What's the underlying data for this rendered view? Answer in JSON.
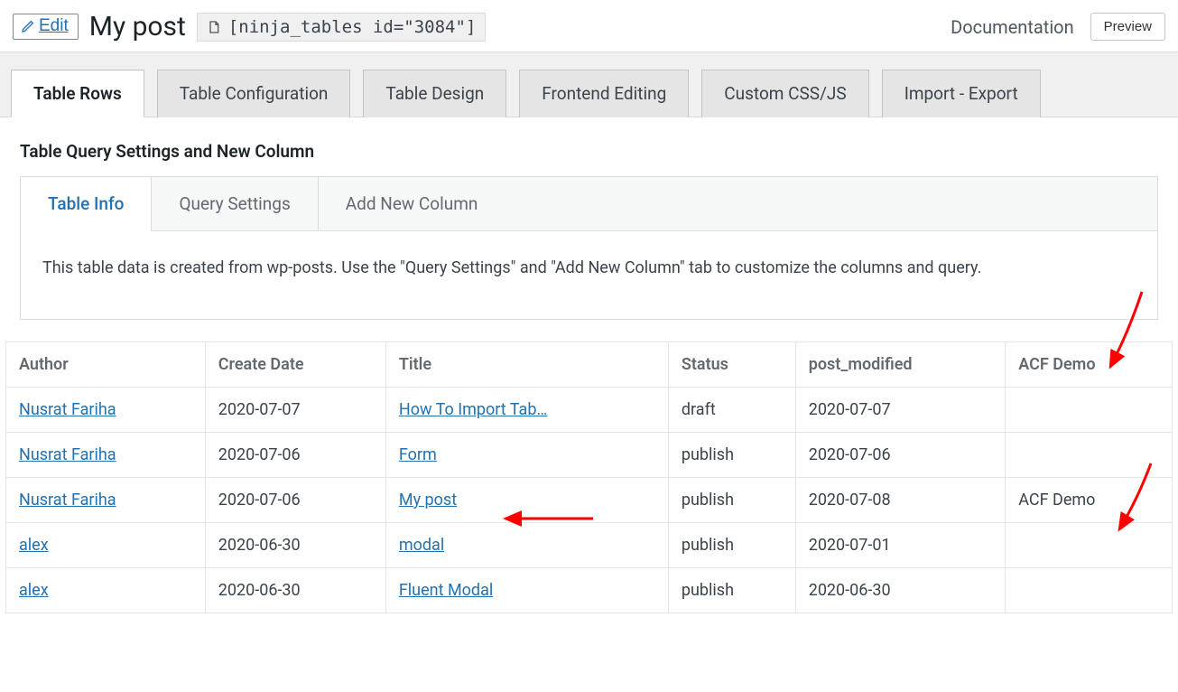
{
  "header": {
    "edit_label": "Edit",
    "title": "My post",
    "shortcode": "[ninja_tables id=\"3084\"]",
    "documentation_label": "Documentation",
    "preview_label": "Preview"
  },
  "main_tabs": [
    {
      "label": "Table Rows",
      "active": true
    },
    {
      "label": "Table Configuration",
      "active": false
    },
    {
      "label": "Table Design",
      "active": false
    },
    {
      "label": "Frontend Editing",
      "active": false
    },
    {
      "label": "Custom CSS/JS",
      "active": false
    },
    {
      "label": "Import - Export",
      "active": false
    }
  ],
  "section_title": "Table Query Settings and New Column",
  "sub_tabs": [
    {
      "label": "Table Info",
      "active": true
    },
    {
      "label": "Query Settings",
      "active": false
    },
    {
      "label": "Add New Column",
      "active": false
    }
  ],
  "info_text": "This table data is created from wp-posts. Use the \"Query Settings\" and \"Add New Column\" tab to customize the columns and query.",
  "table": {
    "columns": [
      "Author",
      "Create Date",
      "Title",
      "Status",
      "post_modified",
      "ACF Demo"
    ],
    "rows": [
      {
        "author": "Nusrat Fariha",
        "create_date": "2020-07-07",
        "title": "How To Import Tab…",
        "status": "draft",
        "post_modified": "2020-07-07",
        "acf_demo": ""
      },
      {
        "author": "Nusrat Fariha",
        "create_date": "2020-07-06",
        "title": "Form",
        "status": "publish",
        "post_modified": "2020-07-06",
        "acf_demo": ""
      },
      {
        "author": "Nusrat Fariha",
        "create_date": "2020-07-06",
        "title": "My post",
        "status": "publish",
        "post_modified": "2020-07-08",
        "acf_demo": "ACF Demo"
      },
      {
        "author": "alex",
        "create_date": "2020-06-30",
        "title": "modal",
        "status": "publish",
        "post_modified": "2020-07-01",
        "acf_demo": ""
      },
      {
        "author": "alex",
        "create_date": "2020-06-30",
        "title": "Fluent Modal",
        "status": "publish",
        "post_modified": "2020-06-30",
        "acf_demo": ""
      }
    ]
  },
  "annotations": {
    "arrow_color": "#ff0000"
  }
}
